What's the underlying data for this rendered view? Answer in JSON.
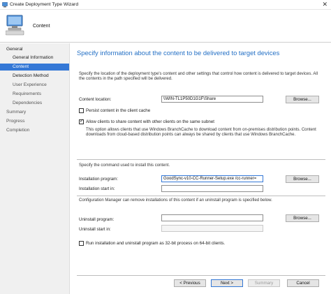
{
  "window": {
    "title": "Create Deployment Type Wizard",
    "close_glyph": "✕"
  },
  "header": {
    "page_name": "Content"
  },
  "sidebar": {
    "items": [
      {
        "label": "General"
      },
      {
        "label": "General Information"
      },
      {
        "label": "Content"
      },
      {
        "label": "Detection Method"
      },
      {
        "label": "User Experience"
      },
      {
        "label": "Requirements"
      },
      {
        "label": "Dependencies"
      },
      {
        "label": "Summary"
      },
      {
        "label": "Progress"
      },
      {
        "label": "Completion"
      }
    ]
  },
  "content": {
    "heading": "Specify information about the content to be delivered to target devices",
    "intro": "Specify the location of the deployment type's content and other settings that control how content is delivered to target devices. All the contents in the path specified will be delivered.",
    "content_location": {
      "label": "Content location:",
      "value": "\\\\WIN-TL1P50D1G1F\\Share",
      "browse": "Browse..."
    },
    "persist_cache": {
      "label": "Persist content in the client cache",
      "checked": false
    },
    "allow_share": {
      "label": "Allow clients to share content with other clients on the same subnet",
      "checked": true
    },
    "branchcache_note": "This option allows clients that use Windows BranchCache to download content from on-premises distribution points. Content downloads from cloud-based distribution points can always be shared by clients that use Windows BranchCache.",
    "command_intro": "Specify the command used to install this content.",
    "installation_program": {
      "label": "Installation program:",
      "value": "GoodSync-v10-CC-Runner-Setup.exe /cc-runner=",
      "browse": "Browse..."
    },
    "installation_start": {
      "label": "Installation start in:",
      "value": ""
    },
    "uninstall_intro": "Configuration Manager can remove installations of this content if an uninstall program is specified below.",
    "uninstall_program": {
      "label": "Uninstall program:",
      "value": "",
      "browse": "Browse..."
    },
    "uninstall_start": {
      "label": "Uninstall start in:",
      "value": ""
    },
    "run_32bit": {
      "label": "Run installation and uninstall program as 32-bit process on 64-bit clients.",
      "checked": false
    }
  },
  "footer": {
    "previous": "< Previous",
    "next": "Next >",
    "summary": "Summary",
    "cancel": "Cancel"
  },
  "colors": {
    "accent": "#3478d6",
    "heading": "#2470c5",
    "sidebar_bg": "#f0f0f0"
  }
}
